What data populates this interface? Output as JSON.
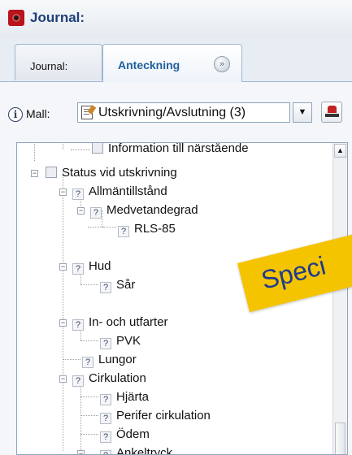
{
  "window": {
    "title": "Journal:"
  },
  "tabs": [
    {
      "label": "Journal:",
      "active": false
    },
    {
      "label": "Anteckning",
      "active": true
    }
  ],
  "template": {
    "label": "Mall:",
    "selected": "Utskrivning/Avslutning (3)"
  },
  "tree": {
    "items": [
      {
        "label": "Information till närstående",
        "icon": "blank-box-icon",
        "level": 2
      },
      {
        "label": "Status vid utskrivning",
        "icon": "blank-box-icon",
        "level": 1,
        "expanded": true
      },
      {
        "label": "Allmäntillstånd",
        "icon": "question-box-icon",
        "level": 2,
        "expanded": true
      },
      {
        "label": "Medvetandegrad",
        "icon": "question-box-icon",
        "level": 3,
        "expanded": true
      },
      {
        "label": "RLS-85",
        "icon": "question-box-icon",
        "level": 4
      },
      {
        "label": "Hud",
        "icon": "question-box-icon",
        "level": 2,
        "expanded": true
      },
      {
        "label": "Sår",
        "icon": "question-box-icon",
        "level": 3
      },
      {
        "label": "In- och utfarter",
        "icon": "question-box-icon",
        "level": 2,
        "expanded": true
      },
      {
        "label": "PVK",
        "icon": "question-box-icon",
        "level": 3
      },
      {
        "label": "Lungor",
        "icon": "question-box-icon",
        "level": 2
      },
      {
        "label": "Cirkulation",
        "icon": "question-box-icon",
        "level": 2,
        "expanded": true
      },
      {
        "label": "Hjärta",
        "icon": "question-box-icon",
        "level": 3
      },
      {
        "label": "Perifer cirkulation",
        "icon": "question-box-icon",
        "level": 3
      },
      {
        "label": "Ödem",
        "icon": "question-box-icon",
        "level": 3
      },
      {
        "label": "Ankeltryck",
        "icon": "question-box-icon",
        "level": 3,
        "expanded": true
      }
    ]
  },
  "overlay": {
    "text": "Speci"
  },
  "colors": {
    "accent": "#1f5f9e",
    "overlay_bg": "#f5c400",
    "overlay_text": "#1d3a8f"
  }
}
